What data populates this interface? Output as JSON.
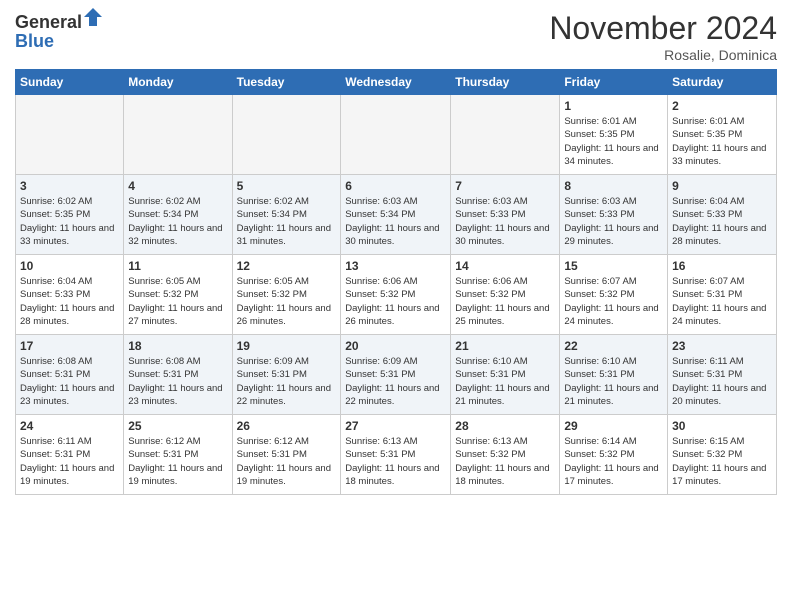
{
  "header": {
    "logo_general": "General",
    "logo_blue": "Blue",
    "month": "November 2024",
    "location": "Rosalie, Dominica"
  },
  "calendar": {
    "weekdays": [
      "Sunday",
      "Monday",
      "Tuesday",
      "Wednesday",
      "Thursday",
      "Friday",
      "Saturday"
    ],
    "weeks": [
      [
        {
          "day": "",
          "info": ""
        },
        {
          "day": "",
          "info": ""
        },
        {
          "day": "",
          "info": ""
        },
        {
          "day": "",
          "info": ""
        },
        {
          "day": "",
          "info": ""
        },
        {
          "day": "1",
          "info": "Sunrise: 6:01 AM\nSunset: 5:35 PM\nDaylight: 11 hours and 34 minutes."
        },
        {
          "day": "2",
          "info": "Sunrise: 6:01 AM\nSunset: 5:35 PM\nDaylight: 11 hours and 33 minutes."
        }
      ],
      [
        {
          "day": "3",
          "info": "Sunrise: 6:02 AM\nSunset: 5:35 PM\nDaylight: 11 hours and 33 minutes."
        },
        {
          "day": "4",
          "info": "Sunrise: 6:02 AM\nSunset: 5:34 PM\nDaylight: 11 hours and 32 minutes."
        },
        {
          "day": "5",
          "info": "Sunrise: 6:02 AM\nSunset: 5:34 PM\nDaylight: 11 hours and 31 minutes."
        },
        {
          "day": "6",
          "info": "Sunrise: 6:03 AM\nSunset: 5:34 PM\nDaylight: 11 hours and 30 minutes."
        },
        {
          "day": "7",
          "info": "Sunrise: 6:03 AM\nSunset: 5:33 PM\nDaylight: 11 hours and 30 minutes."
        },
        {
          "day": "8",
          "info": "Sunrise: 6:03 AM\nSunset: 5:33 PM\nDaylight: 11 hours and 29 minutes."
        },
        {
          "day": "9",
          "info": "Sunrise: 6:04 AM\nSunset: 5:33 PM\nDaylight: 11 hours and 28 minutes."
        }
      ],
      [
        {
          "day": "10",
          "info": "Sunrise: 6:04 AM\nSunset: 5:33 PM\nDaylight: 11 hours and 28 minutes."
        },
        {
          "day": "11",
          "info": "Sunrise: 6:05 AM\nSunset: 5:32 PM\nDaylight: 11 hours and 27 minutes."
        },
        {
          "day": "12",
          "info": "Sunrise: 6:05 AM\nSunset: 5:32 PM\nDaylight: 11 hours and 26 minutes."
        },
        {
          "day": "13",
          "info": "Sunrise: 6:06 AM\nSunset: 5:32 PM\nDaylight: 11 hours and 26 minutes."
        },
        {
          "day": "14",
          "info": "Sunrise: 6:06 AM\nSunset: 5:32 PM\nDaylight: 11 hours and 25 minutes."
        },
        {
          "day": "15",
          "info": "Sunrise: 6:07 AM\nSunset: 5:32 PM\nDaylight: 11 hours and 24 minutes."
        },
        {
          "day": "16",
          "info": "Sunrise: 6:07 AM\nSunset: 5:31 PM\nDaylight: 11 hours and 24 minutes."
        }
      ],
      [
        {
          "day": "17",
          "info": "Sunrise: 6:08 AM\nSunset: 5:31 PM\nDaylight: 11 hours and 23 minutes."
        },
        {
          "day": "18",
          "info": "Sunrise: 6:08 AM\nSunset: 5:31 PM\nDaylight: 11 hours and 23 minutes."
        },
        {
          "day": "19",
          "info": "Sunrise: 6:09 AM\nSunset: 5:31 PM\nDaylight: 11 hours and 22 minutes."
        },
        {
          "day": "20",
          "info": "Sunrise: 6:09 AM\nSunset: 5:31 PM\nDaylight: 11 hours and 22 minutes."
        },
        {
          "day": "21",
          "info": "Sunrise: 6:10 AM\nSunset: 5:31 PM\nDaylight: 11 hours and 21 minutes."
        },
        {
          "day": "22",
          "info": "Sunrise: 6:10 AM\nSunset: 5:31 PM\nDaylight: 11 hours and 21 minutes."
        },
        {
          "day": "23",
          "info": "Sunrise: 6:11 AM\nSunset: 5:31 PM\nDaylight: 11 hours and 20 minutes."
        }
      ],
      [
        {
          "day": "24",
          "info": "Sunrise: 6:11 AM\nSunset: 5:31 PM\nDaylight: 11 hours and 19 minutes."
        },
        {
          "day": "25",
          "info": "Sunrise: 6:12 AM\nSunset: 5:31 PM\nDaylight: 11 hours and 19 minutes."
        },
        {
          "day": "26",
          "info": "Sunrise: 6:12 AM\nSunset: 5:31 PM\nDaylight: 11 hours and 19 minutes."
        },
        {
          "day": "27",
          "info": "Sunrise: 6:13 AM\nSunset: 5:31 PM\nDaylight: 11 hours and 18 minutes."
        },
        {
          "day": "28",
          "info": "Sunrise: 6:13 AM\nSunset: 5:32 PM\nDaylight: 11 hours and 18 minutes."
        },
        {
          "day": "29",
          "info": "Sunrise: 6:14 AM\nSunset: 5:32 PM\nDaylight: 11 hours and 17 minutes."
        },
        {
          "day": "30",
          "info": "Sunrise: 6:15 AM\nSunset: 5:32 PM\nDaylight: 11 hours and 17 minutes."
        }
      ]
    ]
  }
}
